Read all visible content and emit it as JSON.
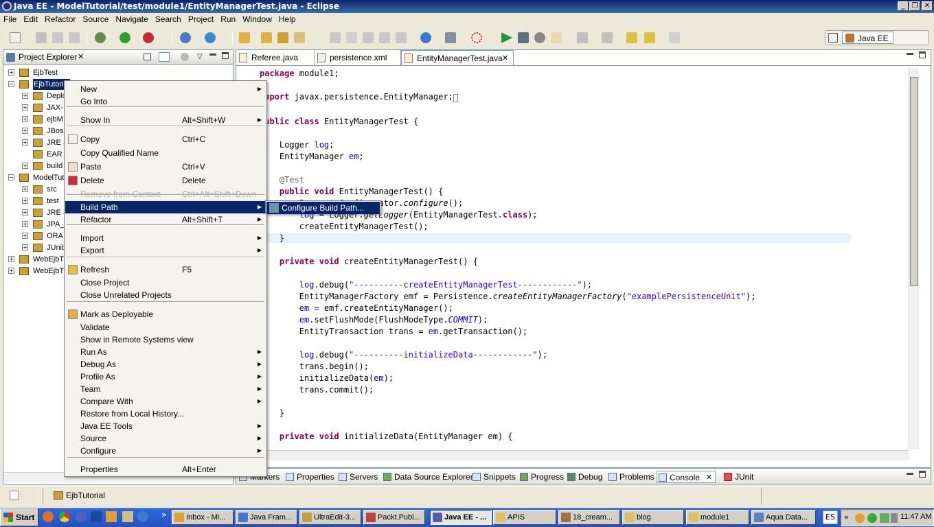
{
  "window": {
    "title": "Java EE - ModelTutorial/test/module1/EntityManagerTest.java - Eclipse"
  },
  "menubar": [
    "File",
    "Edit",
    "Refactor",
    "Source",
    "Navigate",
    "Search",
    "Project",
    "Run",
    "Window",
    "Help"
  ],
  "perspective": {
    "label": "Java EE"
  },
  "explorer": {
    "title": "Project Explorer",
    "items": [
      {
        "label": "EjbTest",
        "toggle": "+"
      },
      {
        "label": "EjbTutorial",
        "toggle": "−"
      },
      {
        "label": "Deplo",
        "toggle": "+"
      },
      {
        "label": "JAX-",
        "toggle": "+"
      },
      {
        "label": "ejbM",
        "toggle": "+"
      },
      {
        "label": "JBoss",
        "toggle": "+"
      },
      {
        "label": "JRE S",
        "toggle": "+"
      },
      {
        "label": "EAR",
        "toggle": ""
      },
      {
        "label": "build",
        "toggle": "+"
      },
      {
        "label": "ModelTut",
        "toggle": "−"
      },
      {
        "label": "src",
        "toggle": "+"
      },
      {
        "label": "test",
        "toggle": "+"
      },
      {
        "label": "JRE S",
        "toggle": "+"
      },
      {
        "label": "JPA_",
        "toggle": "+"
      },
      {
        "label": "ORA",
        "toggle": "+"
      },
      {
        "label": "JUnit",
        "toggle": "+"
      },
      {
        "label": "WebEjbT",
        "toggle": "+"
      },
      {
        "label": "WebEjbT",
        "toggle": "+"
      }
    ]
  },
  "editor": {
    "tabs": [
      {
        "label": "Referee.java"
      },
      {
        "label": "persistence.xml"
      },
      {
        "label": "EntityManagerTest.java"
      }
    ]
  },
  "context_menu": {
    "items": [
      {
        "label": "New",
        "accel": "",
        "submenu": true
      },
      {
        "label": "Go Into",
        "accel": ""
      },
      {
        "label": "Show In",
        "accel": "Alt+Shift+W",
        "submenu": true
      },
      {
        "label": "Copy",
        "accel": "Ctrl+C"
      },
      {
        "label": "Copy Qualified Name",
        "accel": ""
      },
      {
        "label": "Paste",
        "accel": "Ctrl+V"
      },
      {
        "label": "Delete",
        "accel": "Delete"
      },
      {
        "label": "Remove from Context",
        "accel": "Ctrl+Alt+Shift+Down"
      },
      {
        "label": "Build Path",
        "accel": "",
        "submenu": true
      },
      {
        "label": "Refactor",
        "accel": "Alt+Shift+T",
        "submenu": true
      },
      {
        "label": "Import",
        "accel": "",
        "submenu": true
      },
      {
        "label": "Export",
        "accel": "",
        "submenu": true
      },
      {
        "label": "Refresh",
        "accel": "F5"
      },
      {
        "label": "Close Project",
        "accel": ""
      },
      {
        "label": "Close Unrelated Projects",
        "accel": ""
      },
      {
        "label": "Mark as Deployable",
        "accel": ""
      },
      {
        "label": "Validate",
        "accel": ""
      },
      {
        "label": "Show in Remote Systems view",
        "accel": ""
      },
      {
        "label": "Run As",
        "accel": "",
        "submenu": true
      },
      {
        "label": "Debug As",
        "accel": "",
        "submenu": true
      },
      {
        "label": "Profile As",
        "accel": "",
        "submenu": true
      },
      {
        "label": "Team",
        "accel": "",
        "submenu": true
      },
      {
        "label": "Compare With",
        "accel": "",
        "submenu": true
      },
      {
        "label": "Restore from Local History...",
        "accel": ""
      },
      {
        "label": "Java EE Tools",
        "accel": "",
        "submenu": true
      },
      {
        "label": "Source",
        "accel": "",
        "submenu": true
      },
      {
        "label": "Configure",
        "accel": "",
        "submenu": true
      },
      {
        "label": "Properties",
        "accel": "Alt+Enter"
      }
    ]
  },
  "submenu": {
    "label": "Configure Build Path..."
  },
  "bottom_tabs": [
    "Markers",
    "Properties",
    "Servers",
    "Data Source Explorer",
    "Snippets",
    "Progress",
    "Debug",
    "Problems",
    "Console",
    "JUnit"
  ],
  "status": {
    "selected": "EjbTutorial"
  },
  "taskbar": {
    "start": "Start",
    "tasks": [
      "Inbox - Mi...",
      "Java Fram...",
      "UltraEdit-3...",
      "Packt.Publ...",
      "Java EE - ...",
      "APIS",
      "18_cream...",
      "blog",
      "module1",
      "Aqua Data..."
    ],
    "lang": "ES",
    "clock": "11:47 AM"
  }
}
